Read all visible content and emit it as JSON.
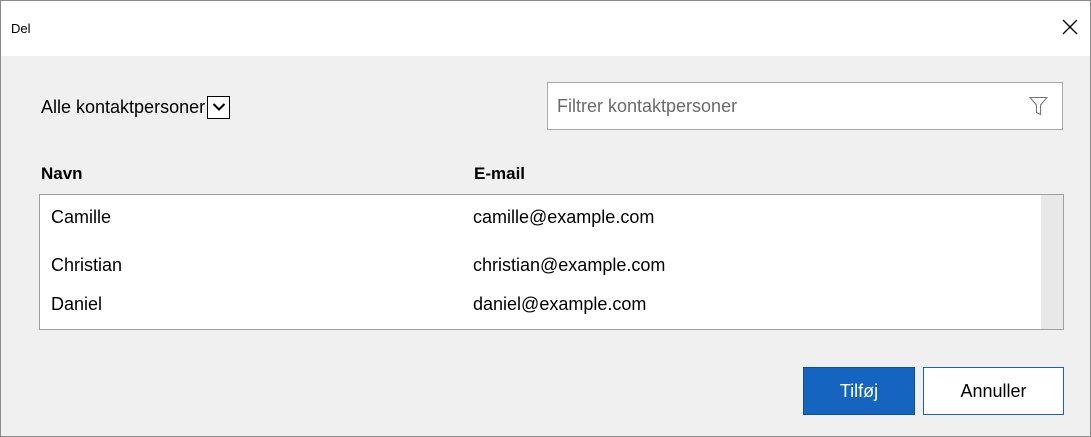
{
  "window": {
    "title": "Del"
  },
  "contacts_filter": {
    "selected": "Alle kontaktpersoner"
  },
  "search": {
    "placeholder": "Filtrer kontaktpersoner",
    "value": ""
  },
  "table": {
    "headers": {
      "name": "Navn",
      "email": "E-mail"
    },
    "rows": [
      {
        "name": "Camille",
        "email": "camille@example.com"
      },
      {
        "name": "Christian",
        "email": "christian@example.com"
      },
      {
        "name": "Daniel",
        "email": "daniel@example.com"
      }
    ]
  },
  "buttons": {
    "add": "Tilføj",
    "cancel": "Annuller"
  },
  "icons": {
    "close": "close-icon",
    "dropdown": "chevron-down-icon",
    "filter": "funnel-icon"
  },
  "colors": {
    "primary": "#1565c0",
    "background": "#f0f0f0"
  }
}
